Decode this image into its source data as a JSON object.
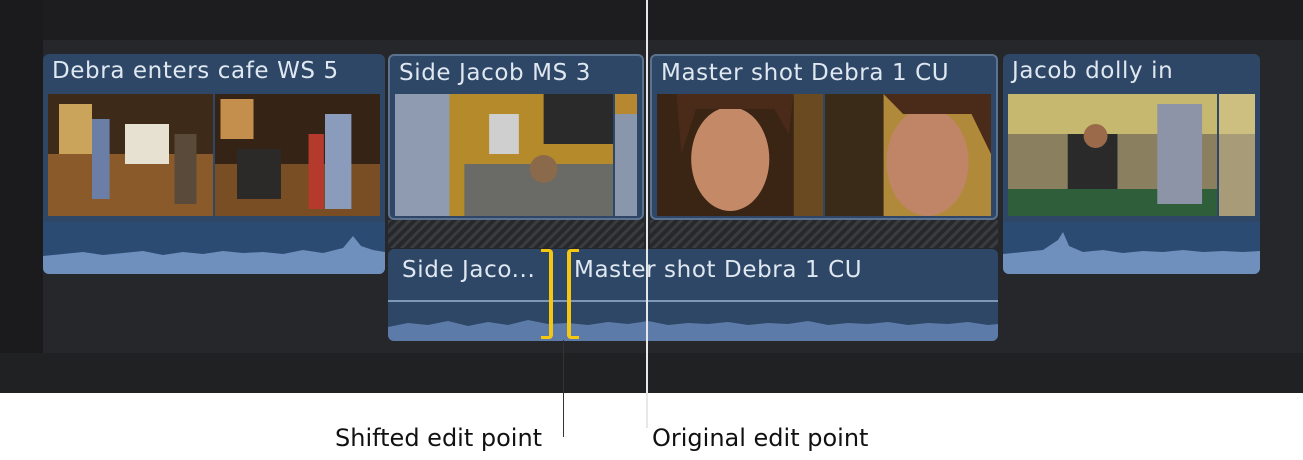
{
  "clips": {
    "c1": {
      "title": "Debra enters cafe WS 5"
    },
    "c2": {
      "title": "Side Jacob MS 3"
    },
    "c3": {
      "title": "Master shot Debra 1 CU"
    },
    "c4": {
      "title": "Jacob dolly in"
    }
  },
  "connected": {
    "left_title": "Side Jaco...",
    "right_title": "Master shot Debra 1 CU"
  },
  "annotations": {
    "shifted": "Shifted edit point",
    "original": "Original edit point"
  },
  "colors": {
    "timeline_bg": "#1d1d20",
    "clip_blue": "#2e4766",
    "audio_blue": "#2b4b72",
    "trim_yellow": "#f5c710"
  }
}
